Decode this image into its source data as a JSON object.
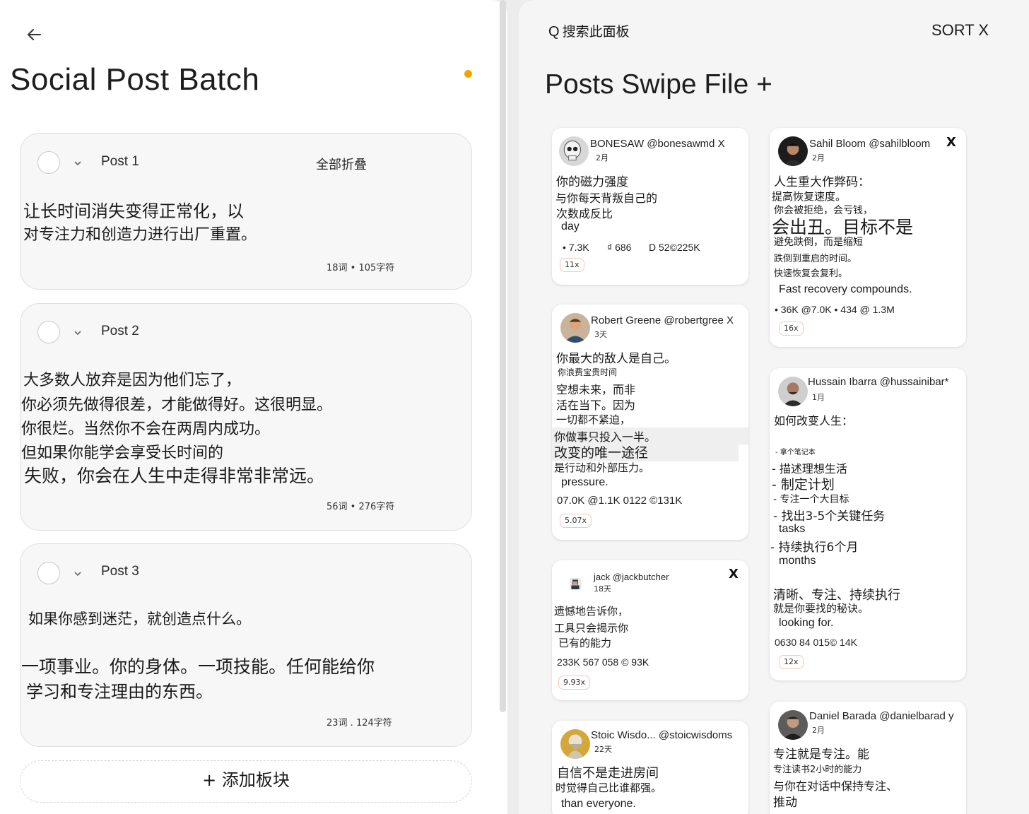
{
  "left": {
    "title": "Social Post Batch",
    "collapse_all": "全部折叠",
    "add_block": "+ 添加板块",
    "posts": [
      {
        "label": "Post 1",
        "lines": [
          "让长时间消失变得正常化，以",
          "对专注力和创造力进行出厂重置。"
        ],
        "stats": "18词 • 105字符"
      },
      {
        "label": "Post 2",
        "lines": [
          "大多数人放弃是因为他们忘了，",
          "你必须先做得很差，才能做得好。这很明显。",
          "你很烂。当然你不会在两周内成功。",
          "但如果你能学会享受长时间的",
          "失败，你会在人生中走得非常非常远。"
        ],
        "stats": "56词 • 276字符"
      },
      {
        "label": "Post 3",
        "lines": [
          "如果你感到迷茫，就创造点什么。",
          "一项事业。你的身体。一项技能。任何能给你",
          "学习和专注理由的东西。"
        ],
        "stats": "23词 . 124字符"
      }
    ]
  },
  "right": {
    "search_placeholder": "搜索此面板",
    "sort_label": "SORT X",
    "title": "Posts Swipe File",
    "title_plus": "+",
    "cards": [
      {
        "author": "BONESAW @bonesawmd X",
        "age": "2月",
        "lines": [
          "你的磁力强度",
          "与你每天背叛自己的",
          "次数成反比",
          "day"
        ],
        "metrics": [
          "• 7.3K",
          "₫ 686",
          "D 52©225K"
        ],
        "multiplier": "11x"
      },
      {
        "author": "Robert Greene @robertgree X",
        "age": "3天",
        "lines": [
          "你最大的敌人是自己。",
          "你浪费宝贵时间",
          "空想未来，而非",
          "活在当下。因为",
          "一切都不紧迫，",
          "你做事只投入一半。",
          "改变的唯一途径",
          "是行动和外部压力。",
          "pressure."
        ],
        "metrics": [
          "07.0K @1.1K 0122 ©131K"
        ],
        "multiplier": "5.07x"
      },
      {
        "author": "jack @jackbutcher",
        "age": "18天",
        "x": "X",
        "lines": [
          "遗憾地告诉你，",
          "工具只会揭示你",
          "已有的能力"
        ],
        "metrics": [
          "233K 567 058 © 93K"
        ],
        "multiplier": "9.93x"
      },
      {
        "author": "Stoic Wisdo... @stoicwisdoms",
        "age": "22天",
        "lines": [
          "自信不是走进房间",
          "时觉得自己比谁都强。",
          "than everyone."
        ]
      },
      {
        "author": "Sahil Bloom @sahilbloom",
        "age": "2月",
        "x": "X",
        "lines": [
          "人生重大作弊码：",
          "提高恢复速度。",
          "你会被拒绝，会亏钱，",
          "会出丑。目标不是",
          "避免跌倒，而是缩短",
          "跌倒到重启的时间。",
          "快速恢复会复利。",
          "Fast recovery compounds."
        ],
        "metrics": [
          "• 36K @7.0K • 434 @ 1.3M"
        ],
        "multiplier": "16x"
      },
      {
        "author": "Hussain Ibarra @hussainibar*",
        "age": "1月",
        "lines": [
          "如何改变人生：",
          "- 拿个笔记本",
          "- 描述理想生活",
          "- 制定计划",
          "- 专注一个大目标",
          "- 找出3-5个关键任务",
          "tasks",
          "- 持续执行6个月",
          "months",
          "清晰、专注、持续执行",
          "就是你要找的秘诀。",
          "looking for."
        ],
        "metrics": [
          "0630 84 015© 14K"
        ],
        "multiplier": "12x"
      },
      {
        "author": "Daniel Barada @danielbarad y",
        "age": "2月",
        "lines": [
          "专注就是专注。能",
          "专注读书2小时的能力",
          "与你在对话中保持专注、",
          "推动"
        ]
      }
    ]
  }
}
